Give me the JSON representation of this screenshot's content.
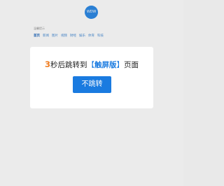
{
  "background": {
    "logo_text": "WDW",
    "section_label": "温馨提示",
    "nav_items": [
      {
        "label": "首页",
        "active": true
      },
      {
        "label": "新闻",
        "active": false
      },
      {
        "label": "图片",
        "active": false
      },
      {
        "label": "视频",
        "active": false
      },
      {
        "label": "财经",
        "active": false
      },
      {
        "label": "娱乐",
        "active": false
      },
      {
        "label": "体育",
        "active": false
      },
      {
        "label": "科技",
        "active": false
      }
    ]
  },
  "dialog": {
    "countdown_seconds": "3",
    "message_prefix": "秒后跳转到",
    "brand_open": "【",
    "brand_name": "触屏版",
    "brand_close": "】",
    "message_suffix": "页面",
    "stay_button_label": "不跳转"
  },
  "colors": {
    "accent": "#1a7be0",
    "countdown": "#ef7d22"
  }
}
